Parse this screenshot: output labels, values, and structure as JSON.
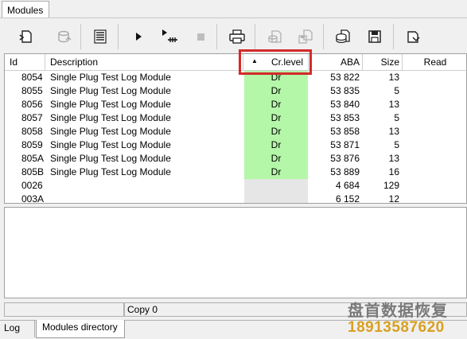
{
  "top_tab": {
    "label": "Modules"
  },
  "toolbar": {
    "buttons": [
      {
        "icon": "module-read-icon",
        "enabled": true
      },
      {
        "icon": "database-icon",
        "enabled": false
      },
      {
        "icon": "list-icon",
        "enabled": true
      },
      {
        "icon": "play-icon",
        "enabled": true
      },
      {
        "icon": "step-icon",
        "enabled": true
      },
      {
        "icon": "stop-icon",
        "enabled": false
      },
      {
        "icon": "print-icon",
        "enabled": true
      },
      {
        "icon": "module-open-icon",
        "enabled": false
      },
      {
        "icon": "module-save-icon",
        "enabled": false
      },
      {
        "icon": "disk-icon",
        "enabled": true
      },
      {
        "icon": "floppy-save-icon",
        "enabled": true
      },
      {
        "icon": "export-icon",
        "enabled": true
      }
    ]
  },
  "table": {
    "columns": {
      "id": "Id",
      "description": "Description",
      "cr_level": "Cr.level",
      "aba": "ABA",
      "size": "Size",
      "read": "Read"
    },
    "sort_indicator": "▲",
    "rows": [
      {
        "id": "8054",
        "description": "Single Plug Test Log Module",
        "cr_level": "Dr",
        "aba": "53 822",
        "size": "13"
      },
      {
        "id": "8055",
        "description": "Single Plug Test Log Module",
        "cr_level": "Dr",
        "aba": "53 835",
        "size": "5"
      },
      {
        "id": "8056",
        "description": "Single Plug Test Log Module",
        "cr_level": "Dr",
        "aba": "53 840",
        "size": "13"
      },
      {
        "id": "8057",
        "description": "Single Plug Test Log Module",
        "cr_level": "Dr",
        "aba": "53 853",
        "size": "5"
      },
      {
        "id": "8058",
        "description": "Single Plug Test Log Module",
        "cr_level": "Dr",
        "aba": "53 858",
        "size": "13"
      },
      {
        "id": "8059",
        "description": "Single Plug Test Log Module",
        "cr_level": "Dr",
        "aba": "53 871",
        "size": "5"
      },
      {
        "id": "805A",
        "description": "Single Plug Test Log Module",
        "cr_level": "Dr",
        "aba": "53 876",
        "size": "13"
      },
      {
        "id": "805B",
        "description": "Single Plug Test Log Module",
        "cr_level": "Dr",
        "aba": "53 889",
        "size": "16"
      },
      {
        "id": "0026",
        "description": "",
        "cr_level": "",
        "aba": "4 684",
        "size": "129"
      },
      {
        "id": "003A",
        "description": "",
        "cr_level": "",
        "aba": "6 152",
        "size": "12"
      }
    ]
  },
  "status": {
    "copy": "Copy 0"
  },
  "bottom_tabs": [
    {
      "label": "Log",
      "active": false
    },
    {
      "label": "Modules directory",
      "active": true
    }
  ],
  "watermark": {
    "line1": "盘首数据恢复",
    "line2": "18913587620"
  },
  "colors": {
    "green_cell": "#b4f7a8",
    "gray_cell": "#e6e6e6",
    "highlight": "#d42a2a",
    "watermark_phone": "#d9a020"
  }
}
